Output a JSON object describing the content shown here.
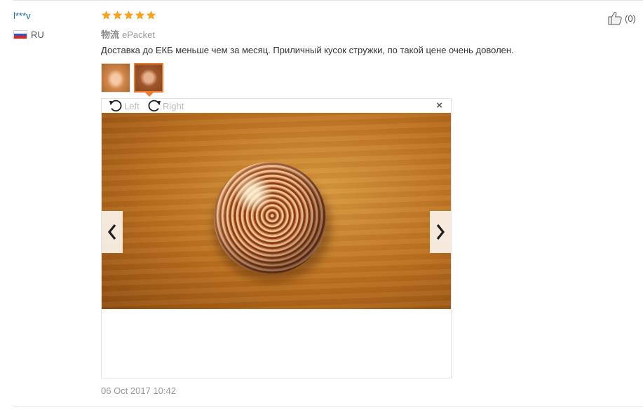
{
  "review": {
    "user_name": "l***v",
    "country": "RU",
    "rating": 5,
    "rating_max": 5,
    "shipping_label": "物流",
    "shipping_method": "ePacket",
    "text": "Доставка до ЕКБ меньше чем за месяц. Приличный кусок стружки, по такой цене очень доволен.",
    "date": "06 Oct 2017 10:42",
    "helpful_count": "(0)"
  },
  "colors": {
    "star": "#f7a21b",
    "user_link": "#1a64b4",
    "thumb_active_border": "#f07a2f",
    "flag": [
      "#ffffff",
      "#2a5cc7",
      "#d62a2a"
    ]
  },
  "viewer": {
    "rotate_left_label": "Left",
    "rotate_right_label": "Right",
    "close_icon": "close-icon",
    "prev_icon": "chevron-left-icon",
    "next_icon": "chevron-right-icon",
    "selected_thumbnail": 2,
    "thumbnail_count": 2
  }
}
